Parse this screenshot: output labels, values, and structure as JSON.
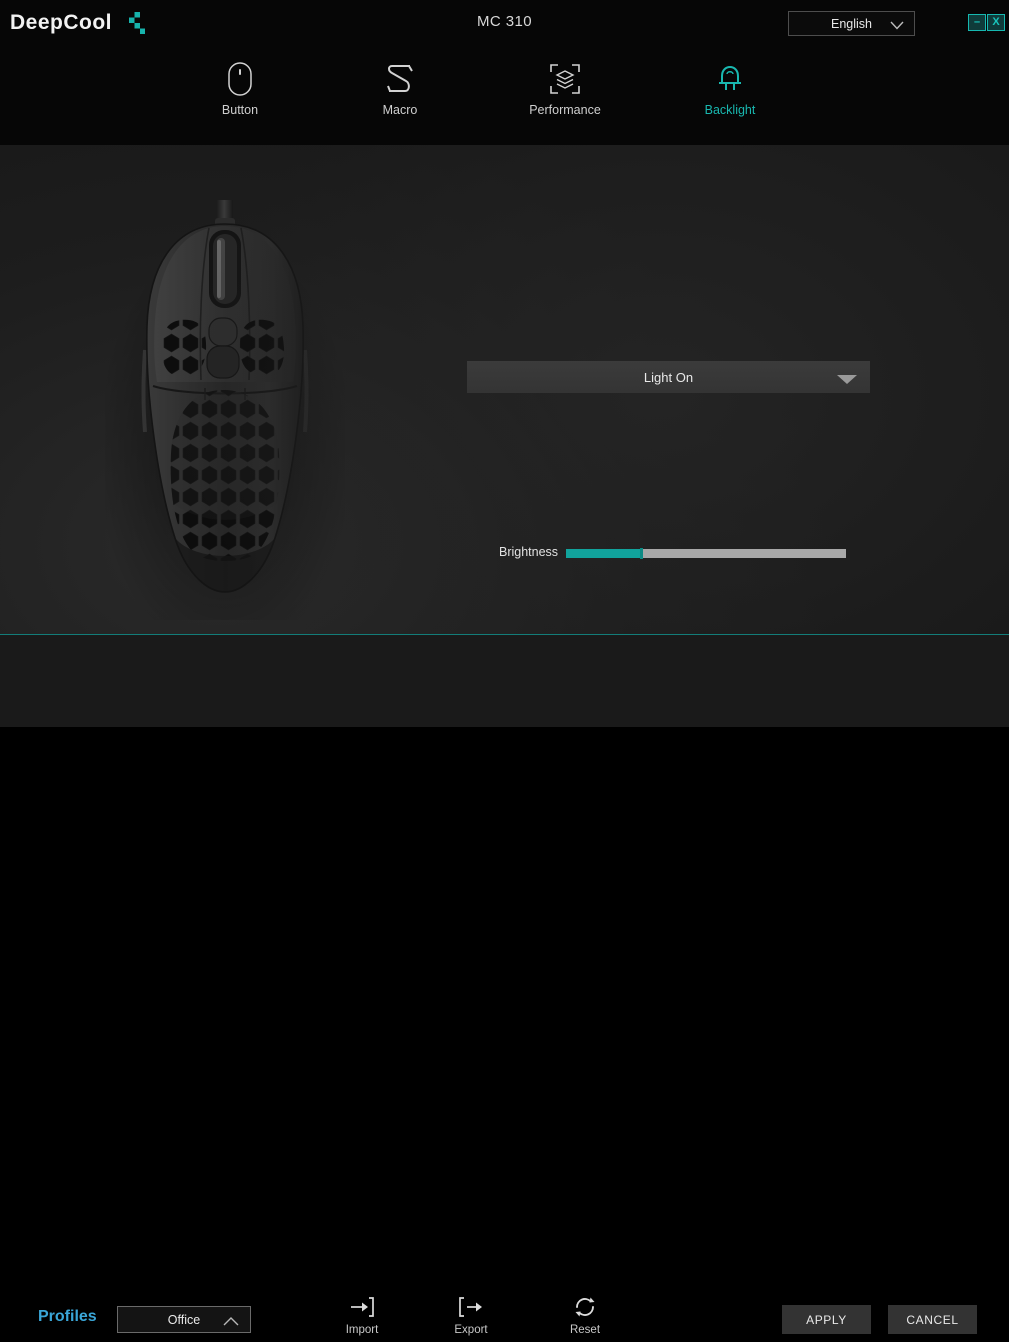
{
  "titlebar": {
    "brand": "DeepCool",
    "brand_mark_icon": "deepcool-logo-mark",
    "title": "MC 310",
    "language": "English",
    "language_caret_icon": "chevron-down-icon",
    "minimize_label": "–",
    "close_label": "X",
    "accent_color": "#19c6bd"
  },
  "nav": {
    "tabs": [
      {
        "label": "Button",
        "icon": "mouse-icon",
        "active": false
      },
      {
        "label": "Macro",
        "icon": "macro-s-icon",
        "active": false
      },
      {
        "label": "Performance",
        "icon": "layers-frame-icon",
        "active": false
      },
      {
        "label": "Backlight",
        "icon": "led-bulb-icon",
        "active": true
      }
    ],
    "active_color": "#19b8b0",
    "inactive_color": "#cfcfcf"
  },
  "main": {
    "device_image": "mc310-mouse-top-view",
    "mode_select": {
      "value": "Light On",
      "caret_icon": "caret-down-icon"
    },
    "brightness": {
      "label": "Brightness",
      "value_percent": 27,
      "fill_color": "#11a39c",
      "track_color": "#a8a8a8"
    }
  },
  "bottom": {
    "profiles_label": "Profiles",
    "profiles_color": "#3aa6d8",
    "profile_select": {
      "value": "Office",
      "caret_icon": "chevron-up-icon"
    },
    "tools": [
      {
        "label": "Import",
        "icon": "import-arrow-icon"
      },
      {
        "label": "Export",
        "icon": "export-arrow-icon"
      },
      {
        "label": "Reset",
        "icon": "refresh-circle-icon"
      }
    ],
    "apply_label": "APPLY",
    "cancel_label": "CANCEL",
    "divider_color": "#137d79"
  }
}
